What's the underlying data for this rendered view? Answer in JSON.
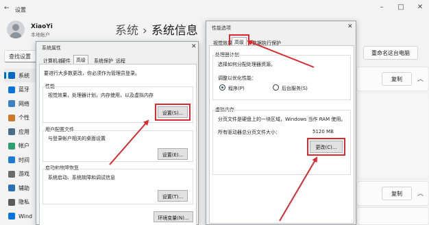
{
  "settings": {
    "app_title": "设置",
    "window_controls": [
      "–",
      "□",
      "✕"
    ],
    "user": {
      "name": "XiaoYi",
      "account_type": "本地帐户"
    },
    "search": "查找设置",
    "nav": [
      {
        "label": "系统",
        "icon": "system-icon",
        "color": "#0067c0"
      },
      {
        "label": "蓝牙",
        "icon": "bluetooth-icon",
        "color": "#0a74da"
      },
      {
        "label": "网络",
        "icon": "network-icon",
        "color": "#3b82c4"
      },
      {
        "label": "个性",
        "icon": "personalization-icon",
        "color": "#c97a2a"
      },
      {
        "label": "应用",
        "icon": "apps-icon",
        "color": "#4b6b8a"
      },
      {
        "label": "帐户",
        "icon": "accounts-icon",
        "color": "#2f9e6e"
      },
      {
        "label": "时间",
        "icon": "time-icon",
        "color": "#1f7ad1"
      },
      {
        "label": "游戏",
        "icon": "gaming-icon",
        "color": "#6b6b6b"
      },
      {
        "label": "辅助",
        "icon": "accessibility-icon",
        "color": "#2a6fb8"
      },
      {
        "label": "隐私",
        "icon": "privacy-icon",
        "color": "#5a5a5a"
      },
      {
        "label": "Wind",
        "icon": "windows-update-icon",
        "color": "#0a74da"
      }
    ],
    "breadcrumb": {
      "parent": "系统",
      "separator": "›",
      "current": "系统信息"
    },
    "rename_button": "重命名这台电脑",
    "copy_button": "复制"
  },
  "system_properties": {
    "title": "系统属性",
    "tabs": [
      "计算机名",
      "硬件",
      "高级",
      "系统保护",
      "远程"
    ],
    "active_tab": "高级",
    "admin_note": "要进行大多数更改，你必须作为管理员登录。",
    "performance": {
      "title": "性能",
      "desc": "视觉效果，处理器计划，内存使用，以及虚拟内存",
      "button": "设置(S)..."
    },
    "user_profiles": {
      "title": "用户配置文件",
      "desc": "与登录帐户相关的桌面设置",
      "button": "设置(E)..."
    },
    "startup_recovery": {
      "title": "启动和故障恢复",
      "desc": "系统启动、系统故障和调试信息",
      "button": "设置(T)..."
    },
    "env_button": "环境变量(N)..."
  },
  "performance_options": {
    "title": "性能选项",
    "tabs": [
      "视觉效果",
      "高级",
      "数据执行保护"
    ],
    "active_tab": "高级",
    "processor": {
      "title": "处理器计划",
      "desc": "选择如何分配处理器资源。",
      "adjust_label": "调整以优化性能：",
      "options": [
        "程序(P)",
        "后台服务(S)"
      ],
      "selected": "程序(P)"
    },
    "virtual_memory": {
      "title": "虚拟内存",
      "desc": "分页文件是硬盘上的一块区域，Windows 当作 RAM 使用。",
      "total_label": "所有驱动器总分页文件大小：",
      "total_value": "5120 MB",
      "button": "更改(C)..."
    }
  },
  "annotation_color": "#d9282f"
}
